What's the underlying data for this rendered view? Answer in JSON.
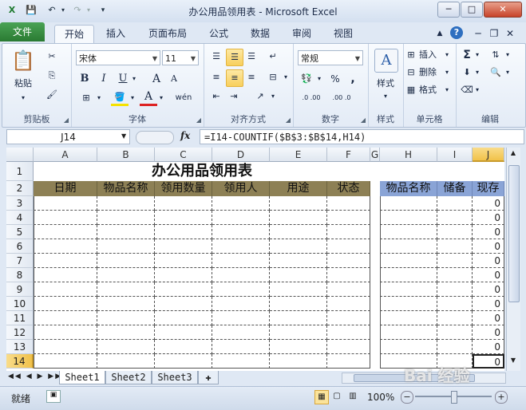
{
  "window": {
    "title": "办公用品领用表 - Microsoft Excel",
    "min_symbol": "─",
    "max_symbol": "□",
    "close_symbol": "✕"
  },
  "ribbon_tabs": [
    "文件",
    "开始",
    "插入",
    "页面布局",
    "公式",
    "数据",
    "审阅",
    "视图"
  ],
  "ribbon": {
    "clipboard": {
      "label": "剪贴板",
      "paste": "粘贴"
    },
    "font": {
      "label": "字体",
      "font_name": "宋体",
      "font_size": "11",
      "bold": "B",
      "italic": "I",
      "underline": "U",
      "grow": "A",
      "shrink": "A",
      "font_color": "A",
      "wen": "wén"
    },
    "alignment": {
      "label": "对齐方式"
    },
    "number": {
      "label": "数字",
      "format": "常规",
      "percent": "%",
      "comma": ",",
      "inc_dec": ".0 .00",
      "dec_dec": ".00 .0"
    },
    "styles": {
      "label": "样式",
      "button": "样式"
    },
    "cells": {
      "label": "单元格",
      "insert": "插入",
      "delete": "删除",
      "format": "格式"
    },
    "editing": {
      "label": "编辑",
      "sum": "Σ"
    }
  },
  "formula_bar": {
    "name_box": "J14",
    "fx": "fx",
    "formula": "=I14-COUNTIF($B$3:$B$14,H14)"
  },
  "columns": [
    "A",
    "B",
    "C",
    "D",
    "E",
    "F",
    "G",
    "H",
    "I",
    "J"
  ],
  "rows": [
    "1",
    "2",
    "3",
    "4",
    "5",
    "6",
    "7",
    "8",
    "9",
    "10",
    "11",
    "12",
    "13",
    "14"
  ],
  "sheet": {
    "title": "办公用品领用表",
    "left_headers": [
      "日期",
      "物品名称",
      "领用数量",
      "领用人",
      "用途",
      "状态"
    ],
    "right_headers": [
      "物品名称",
      "储备",
      "现存"
    ],
    "j_values": [
      "0",
      "0",
      "0",
      "0",
      "0",
      "0",
      "0",
      "0",
      "0",
      "0",
      "0",
      "0"
    ]
  },
  "sheet_tabs": [
    "Sheet1",
    "Sheet2",
    "Sheet3"
  ],
  "status": {
    "ready": "就绪",
    "zoom": "100%",
    "watermark": "Bai 经验"
  },
  "colors": {
    "header_fill_left": "#8d8055",
    "header_fill_right": "#8aa4d6",
    "file_tab": "#2f8a38"
  }
}
